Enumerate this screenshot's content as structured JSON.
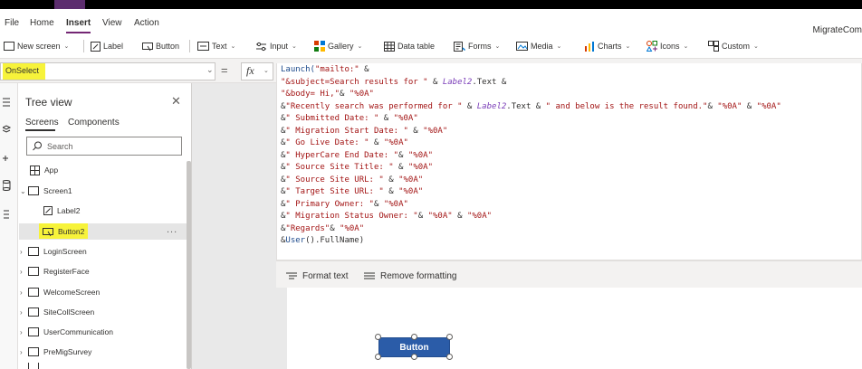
{
  "menu": {
    "tabs": [
      {
        "label": "File"
      },
      {
        "label": "Home"
      },
      {
        "label": "Insert"
      },
      {
        "label": "View"
      },
      {
        "label": "Action"
      }
    ],
    "app_name": "MigrateCom"
  },
  "toolbar": {
    "new_screen": "New screen",
    "label": "Label",
    "button": "Button",
    "text": "Text",
    "input": "Input",
    "gallery": "Gallery",
    "data_table": "Data table",
    "forms": "Forms",
    "media": "Media",
    "charts": "Charts",
    "icons": "Icons",
    "custom": "Custom"
  },
  "formula": {
    "property": "OnSelect",
    "equals": "=",
    "fx": "fx"
  },
  "code": {
    "lines": [
      [
        {
          "t": "fn",
          "v": "Launch("
        },
        {
          "t": "str",
          "v": "\"mailto:\""
        },
        {
          "t": "op",
          "v": " &"
        }
      ],
      [
        {
          "t": "str",
          "v": "\"&subject=Search results for \""
        },
        {
          "t": "op",
          "v": " & "
        },
        {
          "t": "var",
          "v": "Label2"
        },
        {
          "t": "op",
          "v": ".Text &"
        }
      ],
      [
        {
          "t": "str",
          "v": "\"&body= Hi,\""
        },
        {
          "t": "op",
          "v": "& "
        },
        {
          "t": "str",
          "v": "\"%0A\""
        }
      ],
      [
        {
          "t": "op",
          "v": "&"
        },
        {
          "t": "str",
          "v": "\"Recently search was performed for \""
        },
        {
          "t": "op",
          "v": " & "
        },
        {
          "t": "var",
          "v": "Label2"
        },
        {
          "t": "op",
          "v": ".Text & "
        },
        {
          "t": "str",
          "v": "\" and below is the result found.\""
        },
        {
          "t": "op",
          "v": "& "
        },
        {
          "t": "str",
          "v": "\"%0A\""
        },
        {
          "t": "op",
          "v": " & "
        },
        {
          "t": "str",
          "v": "\"%0A\""
        }
      ],
      [
        {
          "t": "op",
          "v": "&"
        },
        {
          "t": "str",
          "v": "\" Submitted Date: \""
        },
        {
          "t": "op",
          "v": " & "
        },
        {
          "t": "str",
          "v": "\"%0A\""
        }
      ],
      [
        {
          "t": "op",
          "v": "&"
        },
        {
          "t": "str",
          "v": "\" Migration Start Date: \""
        },
        {
          "t": "op",
          "v": " & "
        },
        {
          "t": "str",
          "v": "\"%0A\""
        }
      ],
      [
        {
          "t": "op",
          "v": "&"
        },
        {
          "t": "str",
          "v": "\" Go Live Date: \""
        },
        {
          "t": "op",
          "v": " & "
        },
        {
          "t": "str",
          "v": "\"%0A\""
        }
      ],
      [
        {
          "t": "op",
          "v": "&"
        },
        {
          "t": "str",
          "v": "\" HyperCare End Date: \""
        },
        {
          "t": "op",
          "v": "& "
        },
        {
          "t": "str",
          "v": "\"%0A\""
        }
      ],
      [
        {
          "t": "op",
          "v": "&"
        },
        {
          "t": "str",
          "v": "\" Source Site Title: \""
        },
        {
          "t": "op",
          "v": " & "
        },
        {
          "t": "str",
          "v": "\"%0A\""
        }
      ],
      [
        {
          "t": "op",
          "v": "&"
        },
        {
          "t": "str",
          "v": "\" Source Site URL: \""
        },
        {
          "t": "op",
          "v": " & "
        },
        {
          "t": "str",
          "v": "\"%0A\""
        }
      ],
      [
        {
          "t": "op",
          "v": "&"
        },
        {
          "t": "str",
          "v": "\" Target Site URL: \""
        },
        {
          "t": "op",
          "v": " & "
        },
        {
          "t": "str",
          "v": "\"%0A\""
        }
      ],
      [
        {
          "t": "op",
          "v": "&"
        },
        {
          "t": "str",
          "v": "\" Primary Owner: \""
        },
        {
          "t": "op",
          "v": "& "
        },
        {
          "t": "str",
          "v": "\"%0A\""
        }
      ],
      [
        {
          "t": "op",
          "v": "&"
        },
        {
          "t": "str",
          "v": "\" Migration Status Owner: \""
        },
        {
          "t": "op",
          "v": "& "
        },
        {
          "t": "str",
          "v": "\"%0A\""
        },
        {
          "t": "op",
          "v": " & "
        },
        {
          "t": "str",
          "v": "\"%0A\""
        }
      ],
      [
        {
          "t": "op",
          "v": "&"
        },
        {
          "t": "str",
          "v": "\"Regards\""
        },
        {
          "t": "op",
          "v": "& "
        },
        {
          "t": "str",
          "v": "\"%0A\""
        }
      ],
      [
        {
          "t": "op",
          "v": "&"
        },
        {
          "t": "fn",
          "v": "User"
        },
        {
          "t": "op",
          "v": "().FullName)"
        }
      ]
    ]
  },
  "format_bar": {
    "format_text": "Format text",
    "remove_formatting": "Remove formatting"
  },
  "tree_view": {
    "title": "Tree view",
    "tabs": {
      "screens": "Screens",
      "components": "Components"
    },
    "search_placeholder": "Search",
    "items": {
      "app": "App",
      "screen1": "Screen1",
      "label2": "Label2",
      "button2": "Button2",
      "login": "LoginScreen",
      "register": "RegisterFace",
      "welcome": "WelcomeScreen",
      "sitecoll": "SiteCollScreen",
      "usercomm": "UserCommunication",
      "premig": "PreMigSurvey"
    },
    "more": "..."
  },
  "canvas": {
    "button_label": "Button"
  },
  "colors": {
    "accent": "#742774",
    "highlight": "#f7f33a",
    "button_fill": "#2b5ca8"
  }
}
